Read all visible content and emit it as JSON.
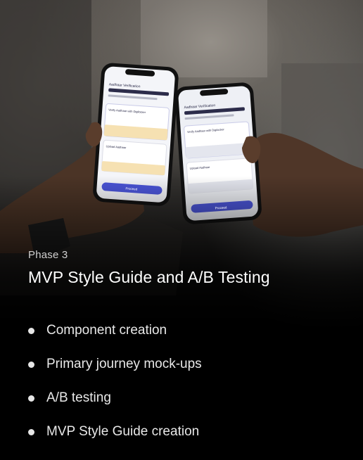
{
  "phase_label": "Phase 3",
  "title": "MVP Style Guide and A/B Testing",
  "bullets": [
    "Component creation",
    "Primary journey mock-ups",
    "A/B testing",
    "MVP Style Guide creation"
  ],
  "phone_screen": {
    "heading": "Aadhaar Verification",
    "option_digilocker": "Verify Aadhaar with Digilocker",
    "option_upload": "Upload Aadhaar",
    "button": "Proceed"
  }
}
